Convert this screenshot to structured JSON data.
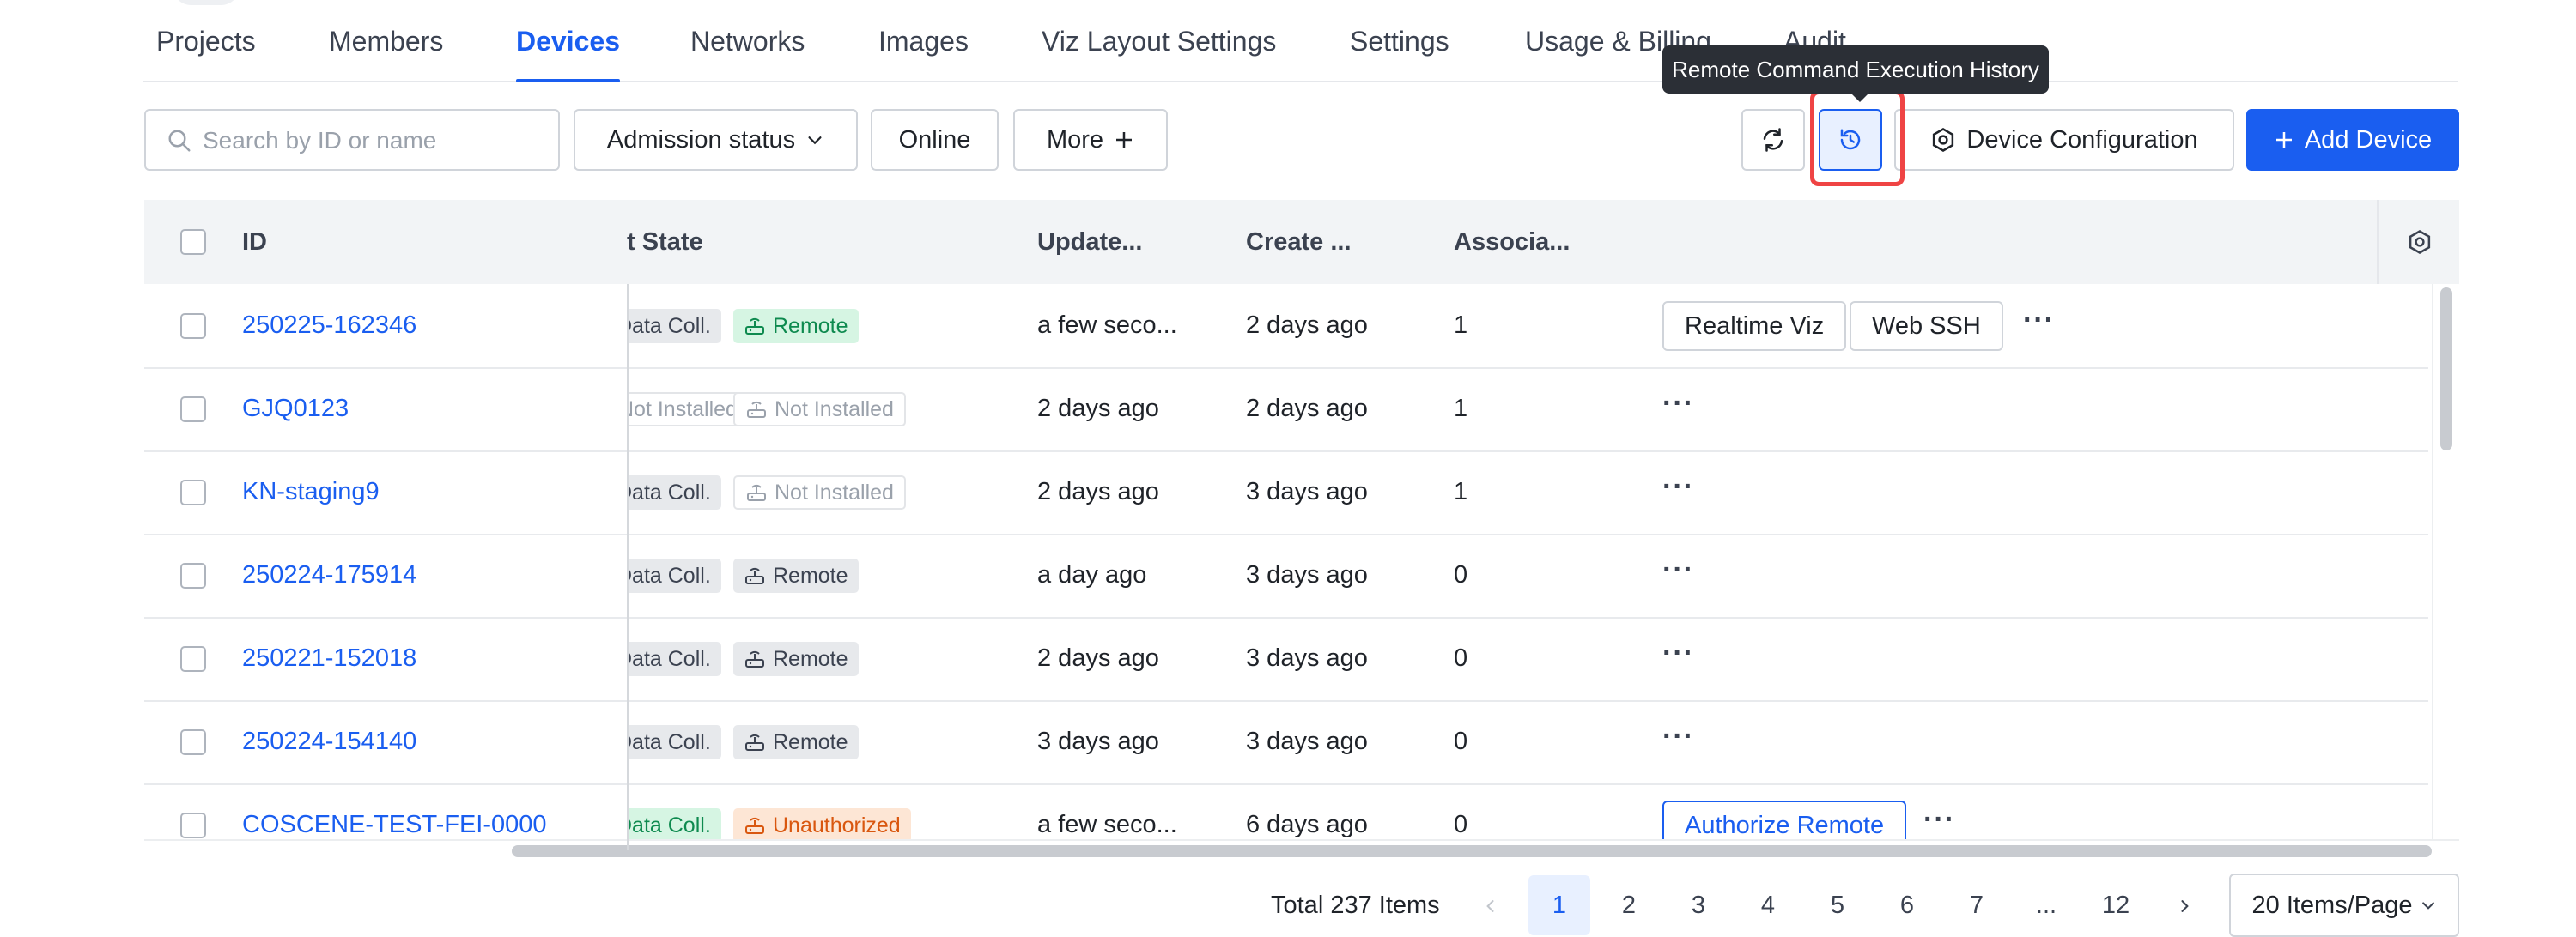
{
  "tabs": [
    {
      "label": "Projects"
    },
    {
      "label": "Members"
    },
    {
      "label": "Devices"
    },
    {
      "label": "Networks"
    },
    {
      "label": "Images"
    },
    {
      "label": "Viz Layout Settings"
    },
    {
      "label": "Settings"
    },
    {
      "label": "Usage & Billing"
    },
    {
      "label": "Audit"
    }
  ],
  "active_tab": "Devices",
  "tooltip": "Remote Command Execution History",
  "toolbar": {
    "search_placeholder": "Search by ID or name",
    "admission_label": "Admission status",
    "online_label": "Online",
    "more_label": "More",
    "device_config_label": "Device Configuration",
    "add_device_label": "Add Device"
  },
  "table": {
    "columns": {
      "id": "ID",
      "state": "t State",
      "updated": "Update...",
      "created": "Create ...",
      "associated": "Associa..."
    },
    "rows": [
      {
        "id": "250225-162346",
        "tag1": {
          "text": "Data Coll.",
          "style": "gray"
        },
        "tag2": {
          "text": "Remote",
          "style": "green",
          "icon": "router-icon"
        },
        "updated": "a few seco...",
        "created": "2 days ago",
        "assoc": "1",
        "actions": [
          "Realtime Viz",
          "Web SSH"
        ],
        "more": "···"
      },
      {
        "id": "GJQ0123",
        "tag1": {
          "text": "Not Installed",
          "style": "outline"
        },
        "tag2": {
          "text": "Not Installed",
          "style": "outline",
          "icon": "router-icon"
        },
        "updated": "2 days ago",
        "created": "2 days ago",
        "assoc": "1",
        "actions": [],
        "more": "···"
      },
      {
        "id": "KN-staging9",
        "tag1": {
          "text": "Data Coll.",
          "style": "gray"
        },
        "tag2": {
          "text": "Not Installed",
          "style": "outline",
          "icon": "router-icon"
        },
        "updated": "2 days ago",
        "created": "3 days ago",
        "assoc": "1",
        "actions": [],
        "more": "···"
      },
      {
        "id": "250224-175914",
        "tag1": {
          "text": "Data Coll.",
          "style": "gray"
        },
        "tag2": {
          "text": "Remote",
          "style": "gray",
          "icon": "router-icon"
        },
        "updated": "a day ago",
        "created": "3 days ago",
        "assoc": "0",
        "actions": [],
        "more": "···"
      },
      {
        "id": "250221-152018",
        "tag1": {
          "text": "Data Coll.",
          "style": "gray"
        },
        "tag2": {
          "text": "Remote",
          "style": "gray",
          "icon": "router-icon"
        },
        "updated": "2 days ago",
        "created": "3 days ago",
        "assoc": "0",
        "actions": [],
        "more": "···"
      },
      {
        "id": "250224-154140",
        "tag1": {
          "text": "Data Coll.",
          "style": "gray"
        },
        "tag2": {
          "text": "Remote",
          "style": "gray",
          "icon": "router-icon"
        },
        "updated": "3 days ago",
        "created": "3 days ago",
        "assoc": "0",
        "actions": [],
        "more": "···"
      },
      {
        "id": "COSCENE-TEST-FEI-0000",
        "tag1": {
          "text": "Data Coll.",
          "style": "green"
        },
        "tag2": {
          "text": "Unauthorized",
          "style": "orange",
          "icon": "router-icon"
        },
        "updated": "a few seco...",
        "created": "6 days ago",
        "assoc": "0",
        "actions": [
          "Authorize Remote"
        ],
        "more": "···"
      }
    ]
  },
  "pagination": {
    "total": "Total 237 Items",
    "pages": [
      "1",
      "2",
      "3",
      "4",
      "5",
      "6",
      "7",
      "...",
      "12"
    ],
    "current": "1",
    "page_size": "20 Items/Page"
  },
  "colors": {
    "accent": "#1a5ef0",
    "highlight": "#ef4444"
  }
}
